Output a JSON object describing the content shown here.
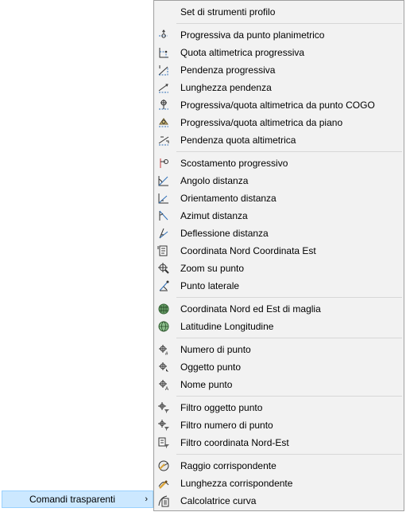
{
  "parent_menu": {
    "label": "Comandi trasparenti",
    "arrow": "›"
  },
  "submenu": {
    "groups": [
      {
        "items": [
          {
            "label": "Set di strumenti profilo",
            "icon": ""
          }
        ]
      },
      {
        "items": [
          {
            "label": "Progressiva da punto planimetrico",
            "icon": "station-from-plan-icon"
          },
          {
            "label": "Quota altimetrica progressiva",
            "icon": "station-elevation-icon"
          },
          {
            "label": "Pendenza progressiva",
            "icon": "grade-station-icon"
          },
          {
            "label": "Lunghezza pendenza",
            "icon": "grade-length-icon"
          },
          {
            "label": "Progressiva/quota altimetrica da punto COGO",
            "icon": "cogo-point-elevation-icon"
          },
          {
            "label": "Progressiva/quota altimetrica da piano",
            "icon": "surface-elevation-icon"
          },
          {
            "label": "Pendenza quota altimetrica",
            "icon": "grade-elevation-icon"
          }
        ]
      },
      {
        "items": [
          {
            "label": "Scostamento progressivo",
            "icon": "station-offset-icon"
          },
          {
            "label": "Angolo distanza",
            "icon": "angle-distance-icon"
          },
          {
            "label": "Orientamento distanza",
            "icon": "bearing-distance-icon"
          },
          {
            "label": "Azimut distanza",
            "icon": "azimuth-distance-icon"
          },
          {
            "label": "Deflessione distanza",
            "icon": "deflection-distance-icon"
          },
          {
            "label": "Coordinata Nord Coordinata Est",
            "icon": "northing-easting-icon"
          },
          {
            "label": "Zoom su punto",
            "icon": "zoom-to-point-icon"
          },
          {
            "label": "Punto laterale",
            "icon": "side-shot-icon"
          }
        ]
      },
      {
        "items": [
          {
            "label": "Coordinata Nord ed Est di maglia",
            "icon": "grid-northing-easting-icon"
          },
          {
            "label": "Latitudine Longitudine",
            "icon": "latitude-longitude-icon"
          }
        ]
      },
      {
        "items": [
          {
            "label": "Numero di punto",
            "icon": "point-number-icon"
          },
          {
            "label": "Oggetto punto",
            "icon": "point-object-icon"
          },
          {
            "label": "Nome punto",
            "icon": "point-name-icon"
          }
        ]
      },
      {
        "items": [
          {
            "label": "Filtro oggetto punto",
            "icon": "point-object-filter-icon"
          },
          {
            "label": "Filtro numero di punto",
            "icon": "point-number-filter-icon"
          },
          {
            "label": "Filtro coordinata Nord-Est",
            "icon": "northing-easting-filter-icon"
          }
        ]
      },
      {
        "items": [
          {
            "label": "Raggio corrispondente",
            "icon": "match-radius-icon"
          },
          {
            "label": "Lunghezza corrispondente",
            "icon": "match-length-icon"
          },
          {
            "label": "Calcolatrice curva",
            "icon": "curve-calculator-icon"
          }
        ]
      }
    ]
  }
}
